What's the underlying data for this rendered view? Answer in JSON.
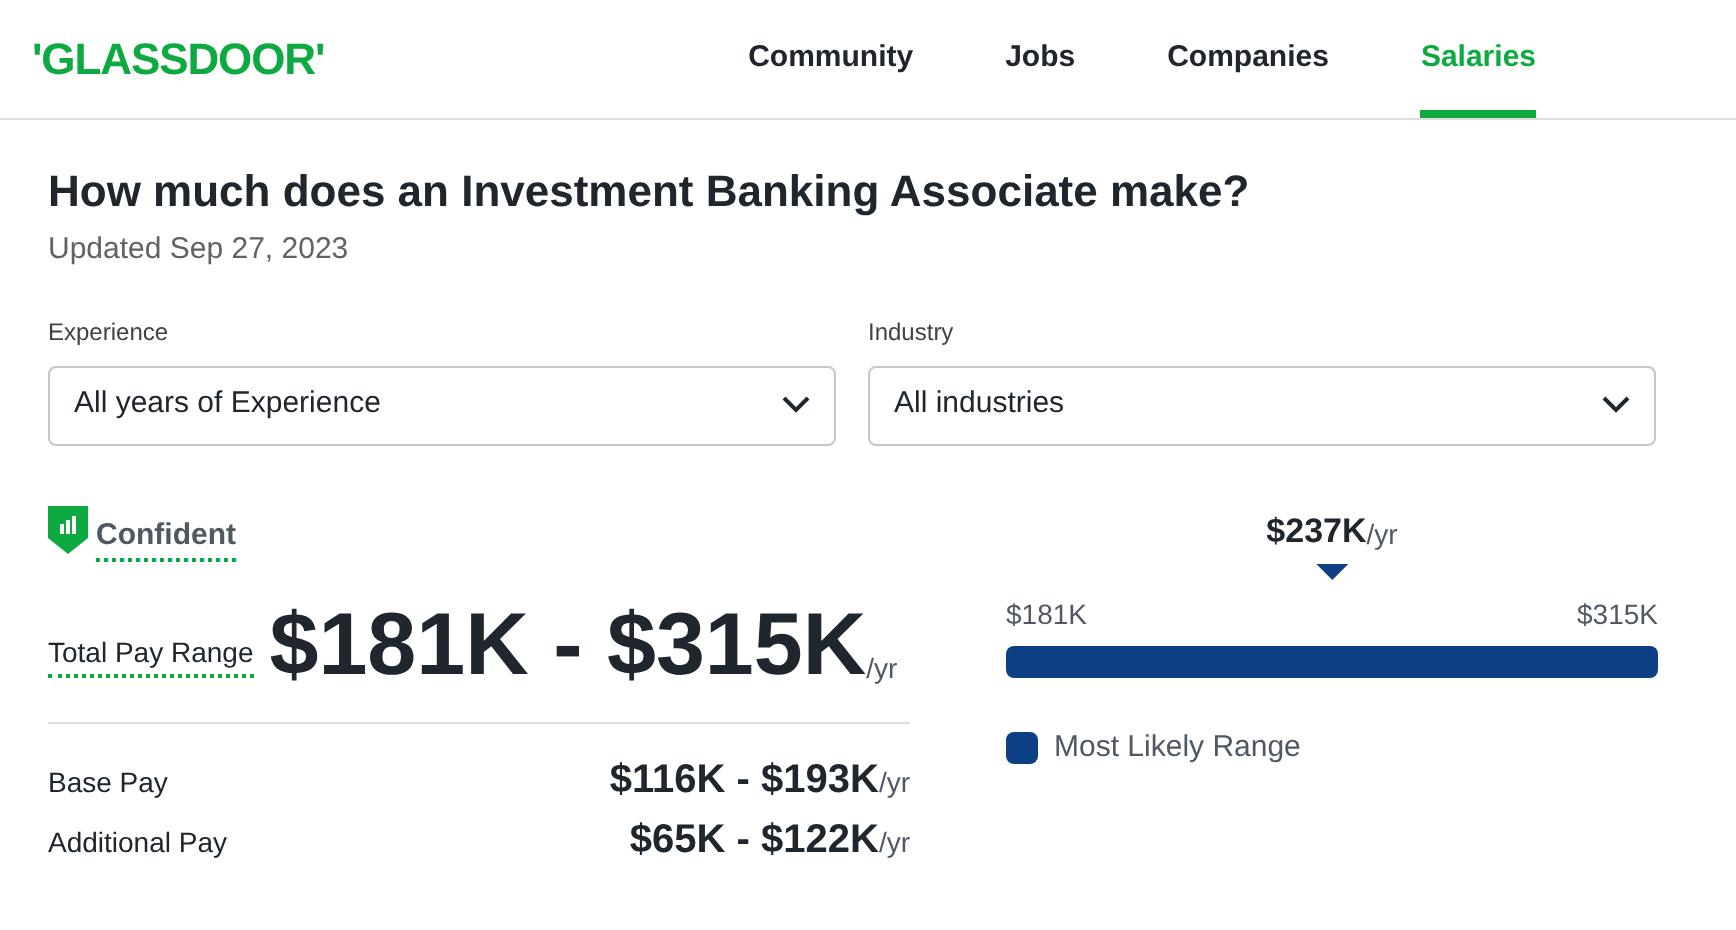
{
  "header": {
    "logo": "'GLASSDOOR'",
    "nav": [
      {
        "label": "Community",
        "selected": false
      },
      {
        "label": "Jobs",
        "selected": false
      },
      {
        "label": "Companies",
        "selected": false
      },
      {
        "label": "Salaries",
        "selected": true
      }
    ]
  },
  "title": "How much does an Investment Banking Associate make?",
  "updated": "Updated Sep 27, 2023",
  "filters": [
    {
      "label": "Experience",
      "value": "All years of Experience"
    },
    {
      "label": "Industry",
      "value": "All industries"
    }
  ],
  "confidence": "Confident",
  "total": {
    "label": "Total Pay Range",
    "value": "$181K - $315K",
    "unit": "/yr"
  },
  "breakdown": [
    {
      "label": "Base Pay",
      "value": "$116K - $193K",
      "unit": "/yr"
    },
    {
      "label": "Additional Pay",
      "value": "$65K - $122K",
      "unit": "/yr"
    }
  ],
  "range": {
    "median": "$237K",
    "median_unit": "/yr",
    "min": "$181K",
    "max": "$315K",
    "legend": "Most Likely Range"
  }
}
